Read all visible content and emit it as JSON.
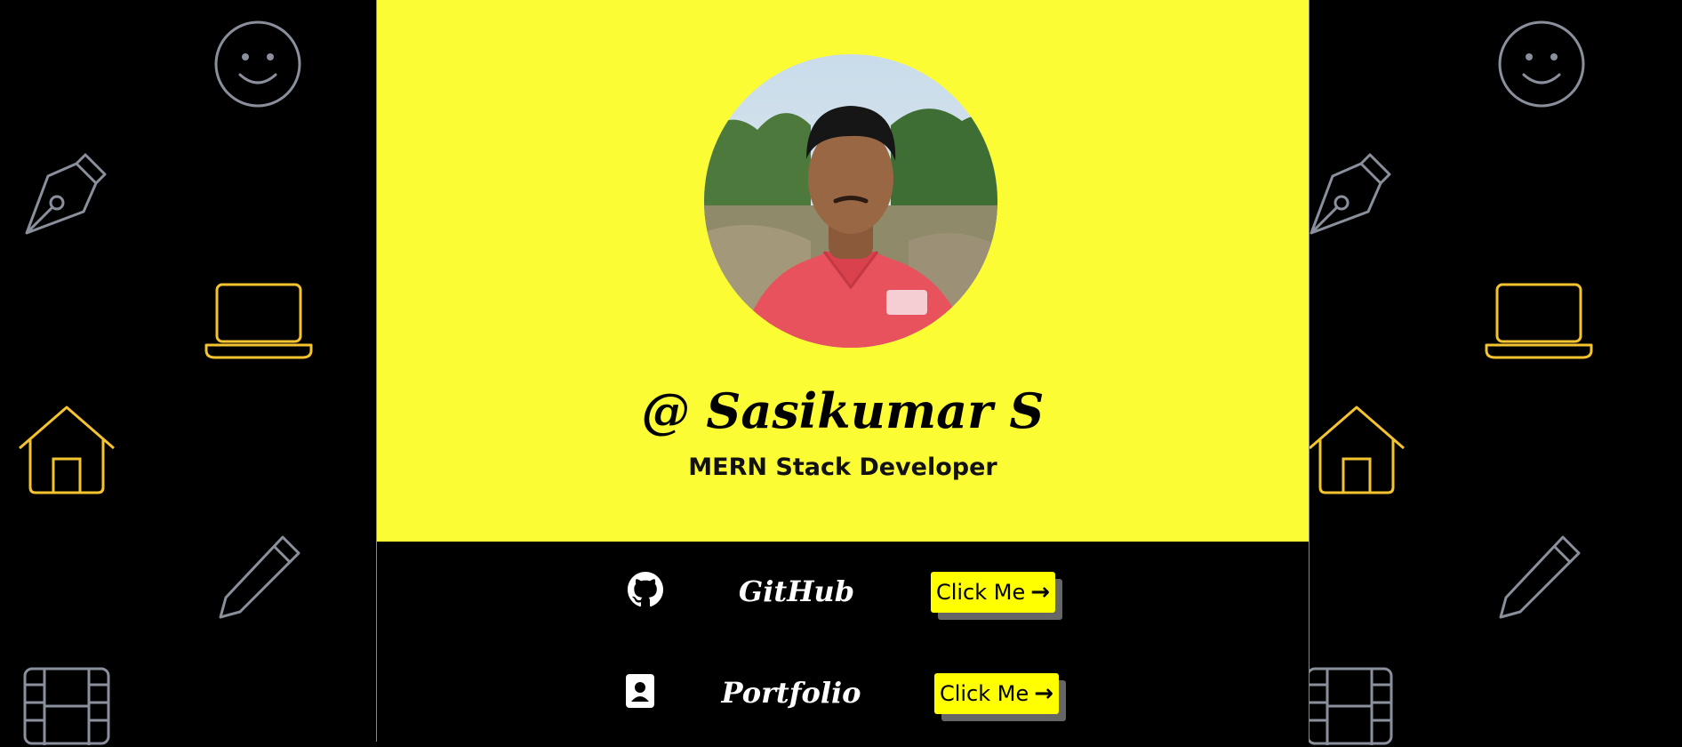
{
  "profile": {
    "display_name": "@ Sasikumar S",
    "tagline": "MERN Stack Developer",
    "avatar_alt": "Sasikumar S"
  },
  "links": [
    {
      "icon": "github-icon",
      "title": "GitHub",
      "button_label": "Click Me"
    },
    {
      "icon": "contact-card-icon",
      "title": "Portfolio",
      "button_label": "Click Me"
    }
  ],
  "background_icons": [
    "smiley-face-icon",
    "pen-nib-icon",
    "laptop-icon",
    "home-icon",
    "pencil-icon",
    "film-strip-icon"
  ],
  "colors": {
    "hero_background": "#fcfc35",
    "page_background": "#000000",
    "button_background": "#ffff00",
    "outline_gray": "#8a8f9c",
    "outline_yellow": "#f4c430",
    "link_title": "#ffffff"
  }
}
